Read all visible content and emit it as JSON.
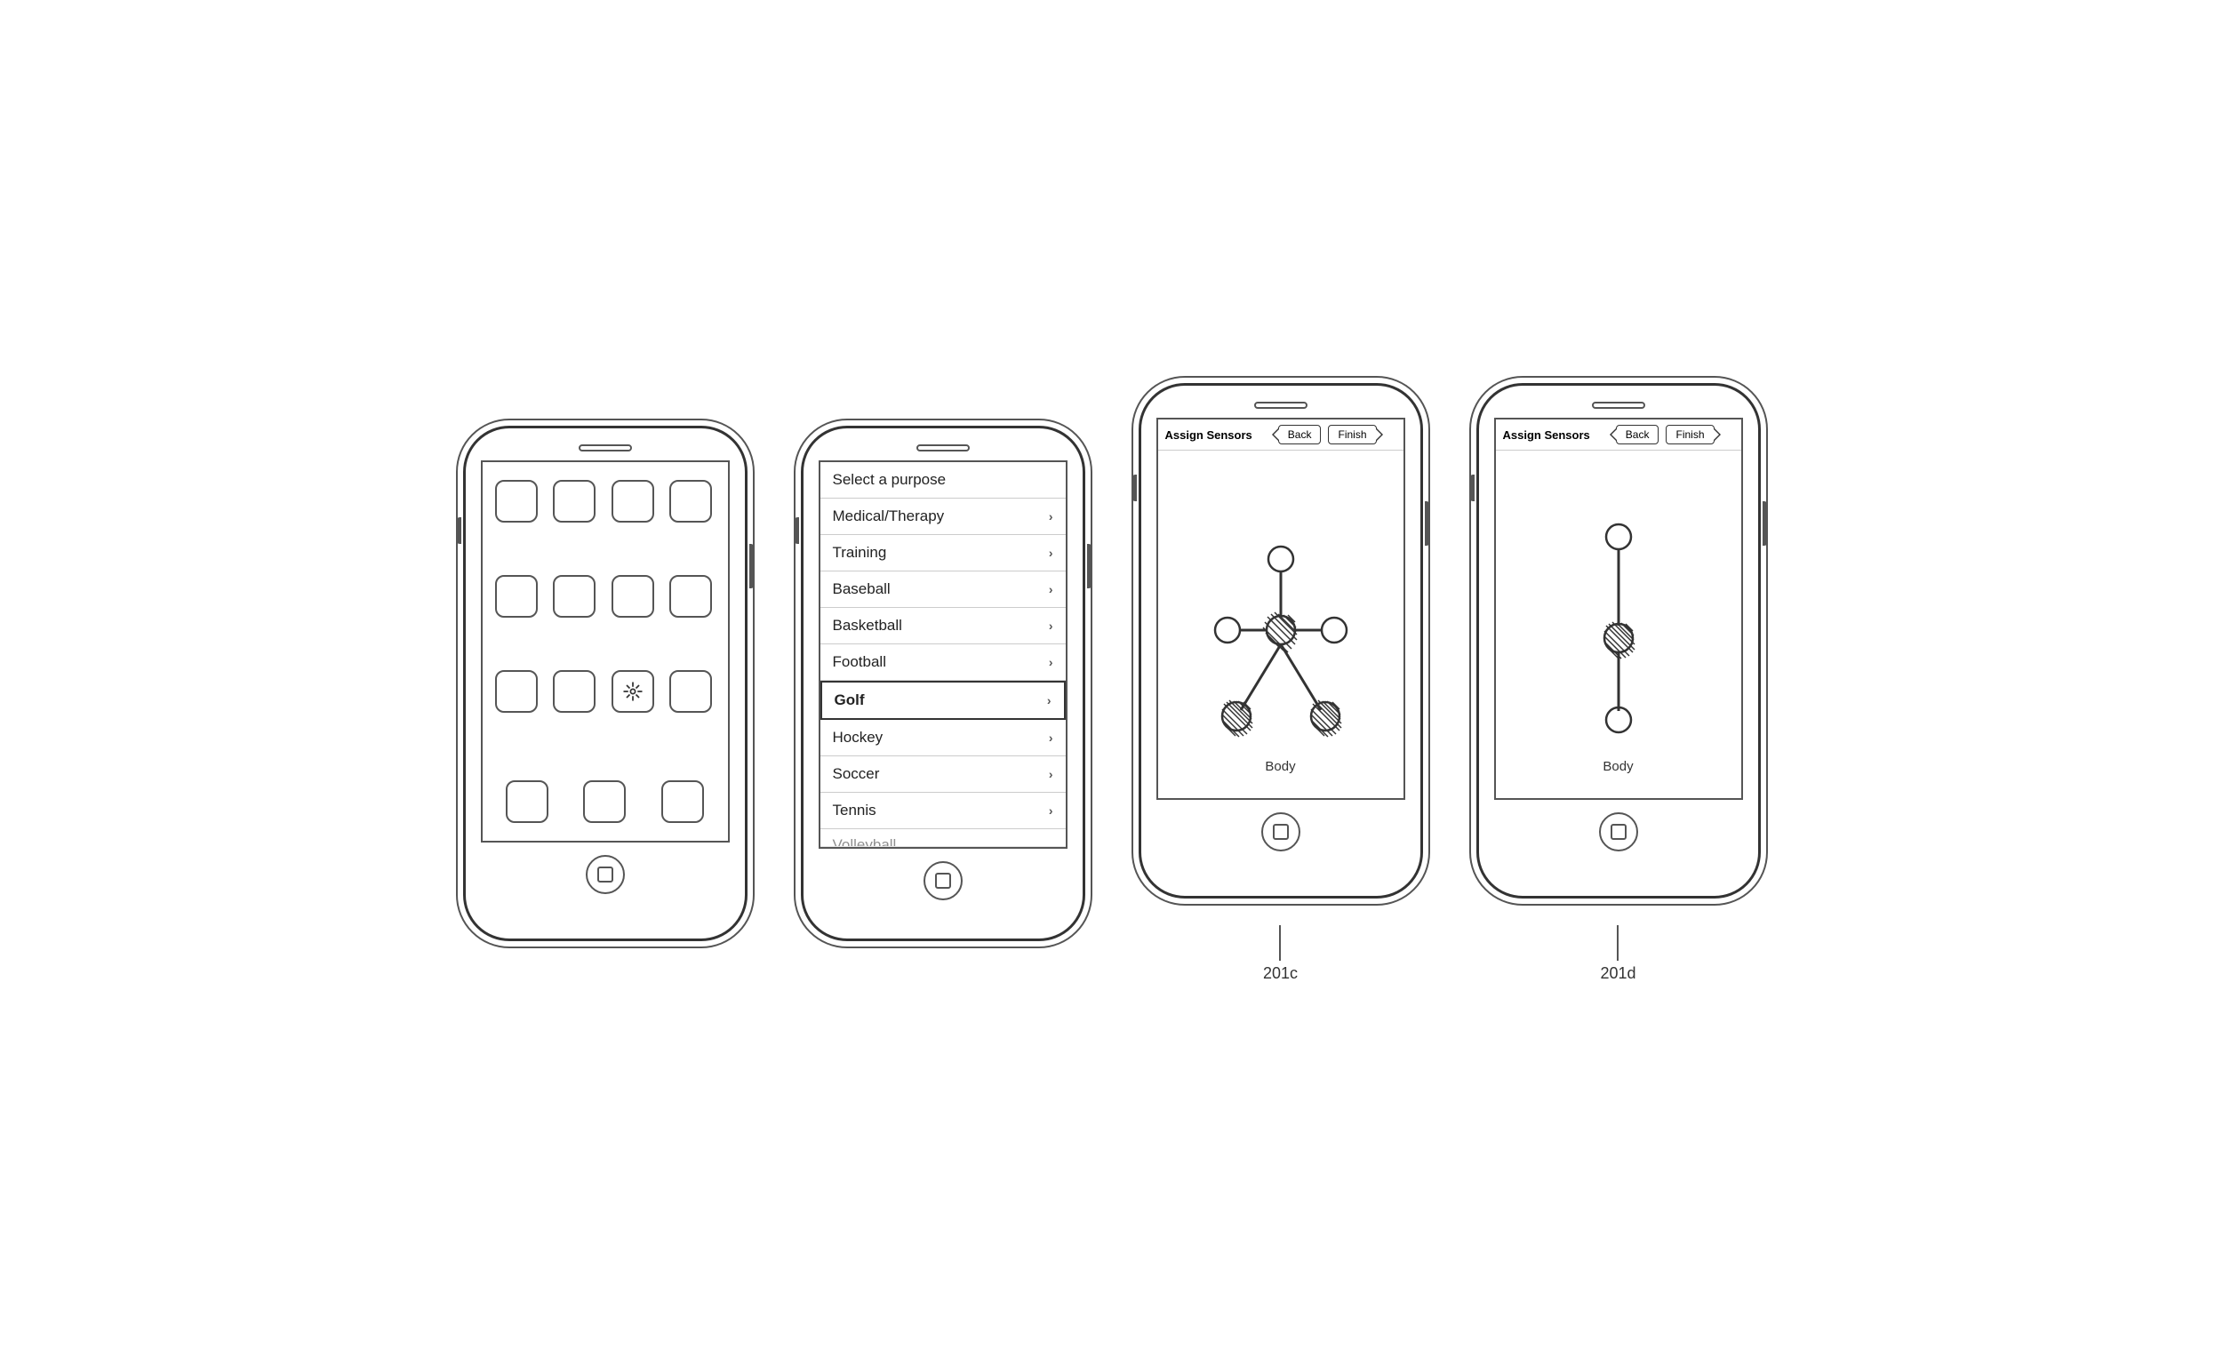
{
  "phones": [
    {
      "id": "phone1",
      "type": "app-grid",
      "label": null
    },
    {
      "id": "phone2",
      "type": "menu",
      "label": null,
      "menu": {
        "header": "Select a purpose",
        "items": [
          {
            "label": "Medical/Therapy",
            "hasArrow": true,
            "selected": false
          },
          {
            "label": "Training",
            "hasArrow": true,
            "selected": false
          },
          {
            "label": "Baseball",
            "hasArrow": true,
            "selected": false
          },
          {
            "label": "Basketball",
            "hasArrow": true,
            "selected": false
          },
          {
            "label": "Football",
            "hasArrow": true,
            "selected": false
          },
          {
            "label": "Golf",
            "hasArrow": true,
            "selected": true
          },
          {
            "label": "Hockey",
            "hasArrow": true,
            "selected": false
          },
          {
            "label": "Soccer",
            "hasArrow": true,
            "selected": false
          },
          {
            "label": "Tennis",
            "hasArrow": true,
            "selected": false
          }
        ],
        "partialItem": "Volleyball..."
      }
    },
    {
      "id": "phone3",
      "type": "sensors-full",
      "label": "201c",
      "header": {
        "title": "Assign Sensors",
        "back": "Back",
        "finish": "Finish"
      },
      "bodyLabel": "Body"
    },
    {
      "id": "phone4",
      "type": "sensors-partial",
      "label": "201d",
      "header": {
        "title": "Assign Sensors",
        "back": "Back",
        "finish": "Finish"
      },
      "bodyLabel": "Body"
    }
  ]
}
